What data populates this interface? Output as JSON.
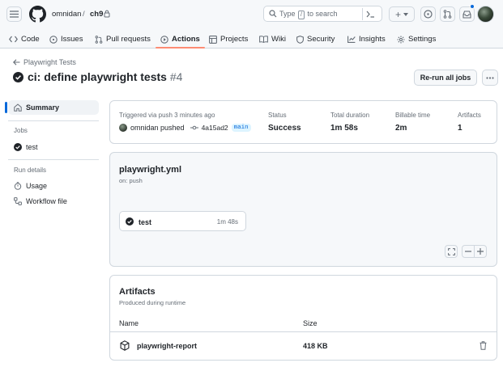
{
  "header": {
    "owner": "omnidan",
    "separator": "/",
    "repo": "ch9",
    "search_prefix": "Type",
    "search_key": "/",
    "search_suffix": "to search",
    "plus_label": "+"
  },
  "tabs": [
    {
      "label": "Code",
      "icon": "code-icon"
    },
    {
      "label": "Issues",
      "icon": "issue-icon"
    },
    {
      "label": "Pull requests",
      "icon": "pull-request-icon"
    },
    {
      "label": "Actions",
      "icon": "play-icon",
      "active": true
    },
    {
      "label": "Projects",
      "icon": "table-icon"
    },
    {
      "label": "Wiki",
      "icon": "book-icon"
    },
    {
      "label": "Security",
      "icon": "shield-icon"
    },
    {
      "label": "Insights",
      "icon": "graph-icon"
    },
    {
      "label": "Settings",
      "icon": "gear-icon"
    }
  ],
  "page": {
    "back_label": "Playwright Tests",
    "title": "ci: define playwright tests",
    "run_number": "#4",
    "rerun_label": "Re-run all jobs"
  },
  "sidebar": {
    "summary": "Summary",
    "jobs_heading": "Jobs",
    "job_test": "test",
    "run_details_heading": "Run details",
    "usage": "Usage",
    "workflow_file": "Workflow file"
  },
  "summary": {
    "trigger_label": "Triggered via push 3 minutes ago",
    "actor_text": "omnidan pushed",
    "commit_sha": "4a15ad2",
    "branch": "main",
    "status_label": "Status",
    "status_value": "Success",
    "duration_label": "Total duration",
    "duration_value": "1m 58s",
    "billable_label": "Billable time",
    "billable_value": "2m",
    "artifacts_label": "Artifacts",
    "artifacts_value": "1"
  },
  "workflow": {
    "file": "playwright.yml",
    "event": "on: push",
    "job_name": "test",
    "job_time": "1m 48s"
  },
  "artifacts": {
    "title": "Artifacts",
    "subtitle": "Produced during runtime",
    "col_name": "Name",
    "col_size": "Size",
    "rows": [
      {
        "name": "playwright-report",
        "size": "418 KB"
      }
    ]
  },
  "colors": {
    "success": "#1f2328",
    "accent": "#0969da",
    "active_tab_underline": "#fd8c73"
  }
}
